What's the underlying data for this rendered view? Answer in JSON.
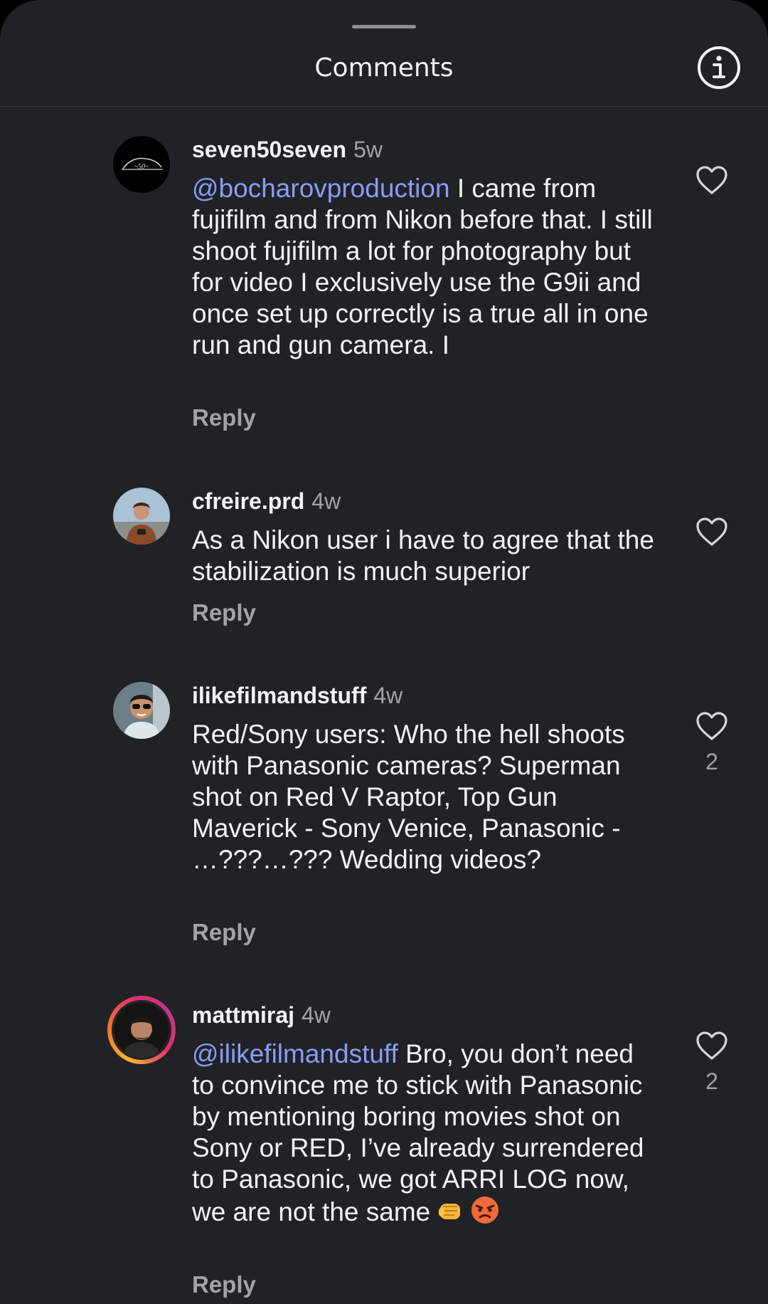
{
  "header": {
    "title": "Comments"
  },
  "comments": [
    {
      "username": "seven50seven",
      "time": "5w",
      "mention": "@bocharovproduction",
      "text": " I came from fujifilm and from Nikon before that. I still shoot fujifilm a lot for photography but for video I exclusively use the G9ii and once set up correctly is a true all in one run and gun camera. I",
      "reply_label": "Reply",
      "likes": ""
    },
    {
      "username": "cfreire.prd",
      "time": "4w",
      "mention": "",
      "text": "As a Nikon user i have to agree that the stabilization is much superior",
      "reply_label": "Reply",
      "likes": ""
    },
    {
      "username": "ilikefilmandstuff",
      "time": "4w",
      "mention": "",
      "text": "Red/Sony users: Who the hell shoots with Panasonic cameras? Superman shot on Red V Raptor, Top Gun Maverick - Sony Venice, Panasonic - …???…??? Wedding videos?",
      "reply_label": "Reply",
      "likes": "2"
    },
    {
      "username": "mattmiraj",
      "time": "4w",
      "mention": "@ilikefilmandstuff",
      "text": " Bro, you don’t need to convince me to stick with Panasonic by mentioning boring movies shot on Sony or RED, I’ve already surrendered to Panasonic, we got ARRI LOG now, we are not the same",
      "reply_label": "Reply",
      "likes": "2",
      "emojis": [
        "fist-emoji",
        "angry-face-emoji"
      ]
    }
  ],
  "colors": {
    "background": "#212226",
    "text": "#f2f3f5",
    "muted": "#a1a3aa",
    "mention": "#8b9cf7",
    "story_ring": "#e1306c"
  }
}
